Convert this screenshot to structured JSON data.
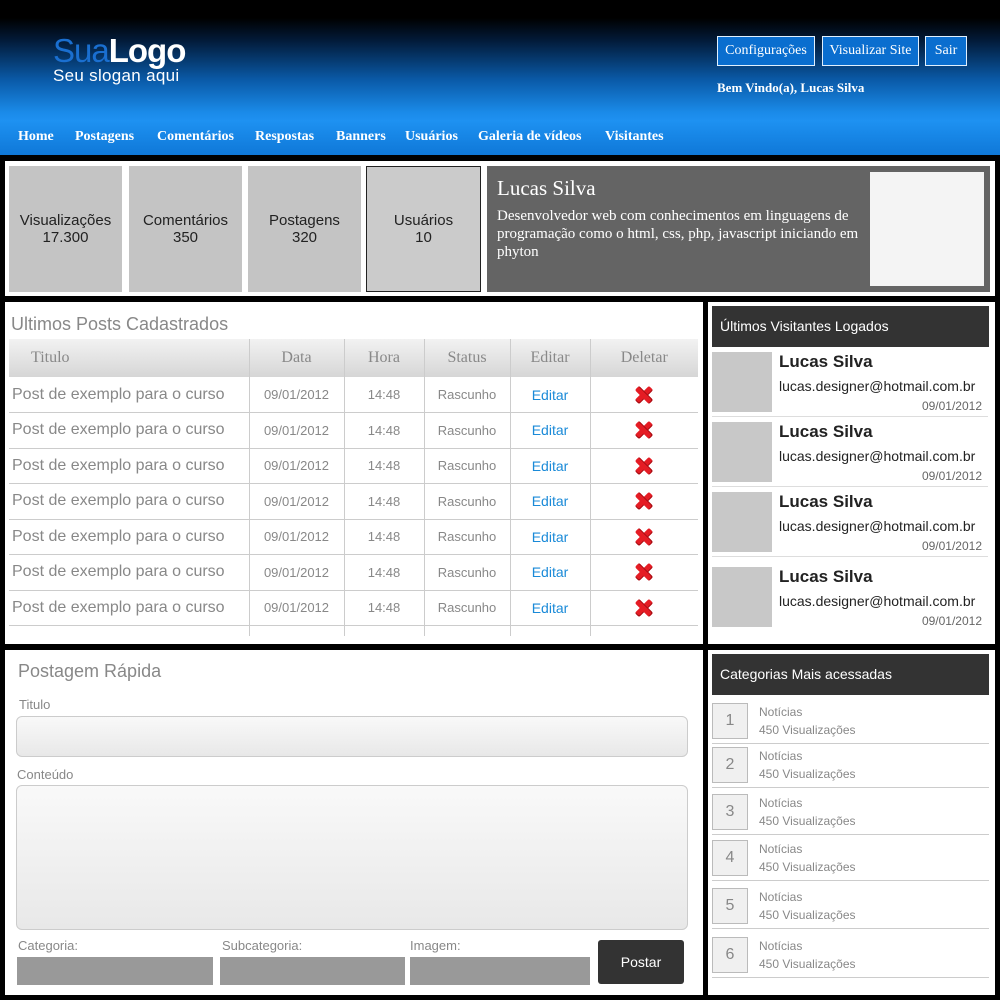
{
  "header": {
    "logo_sua": "Sua",
    "logo_main": "Logo",
    "slogan": "Seu slogan aqui",
    "buttons": [
      "Configurações",
      "Visualizar Site",
      "Sair"
    ],
    "welcome": "Bem Vindo(a), Lucas Silva"
  },
  "nav": [
    "Home",
    "Postagens",
    "Comentários",
    "Respostas",
    "Banners",
    "Usuários",
    "Galeria de vídeos",
    "Visitantes"
  ],
  "stats": [
    {
      "label": "Visualizações",
      "value": "17.300"
    },
    {
      "label": "Comentários",
      "value": "350"
    },
    {
      "label": "Postagens",
      "value": "320"
    },
    {
      "label": "Usuários",
      "value": "10"
    }
  ],
  "profile": {
    "name": "Lucas Silva",
    "description": "Desenvolvedor web com conhecimentos em linguagens de programação como o html, css, php, javascript iniciando em phyton"
  },
  "posts": {
    "title": "Ultimos Posts Cadastrados",
    "columns": [
      "Titulo",
      "Data",
      "Hora",
      "Status",
      "Editar",
      "Deletar"
    ],
    "rows": [
      {
        "title": "Post de exemplo para o curso",
        "date": "09/01/2012",
        "time": "14:48",
        "status": "Rascunho",
        "edit": "Editar"
      },
      {
        "title": "Post de exemplo para o curso",
        "date": "09/01/2012",
        "time": "14:48",
        "status": "Rascunho",
        "edit": "Editar"
      },
      {
        "title": "Post de exemplo para o curso",
        "date": "09/01/2012",
        "time": "14:48",
        "status": "Rascunho",
        "edit": "Editar"
      },
      {
        "title": "Post de exemplo para o curso",
        "date": "09/01/2012",
        "time": "14:48",
        "status": "Rascunho",
        "edit": "Editar"
      },
      {
        "title": "Post de exemplo para o curso",
        "date": "09/01/2012",
        "time": "14:48",
        "status": "Rascunho",
        "edit": "Editar"
      },
      {
        "title": "Post de exemplo para o curso",
        "date": "09/01/2012",
        "time": "14:48",
        "status": "Rascunho",
        "edit": "Editar"
      },
      {
        "title": "Post de exemplo para o curso",
        "date": "09/01/2012",
        "time": "14:48",
        "status": "Rascunho",
        "edit": "Editar"
      }
    ]
  },
  "visitors": {
    "title": "Últimos Visitantes Logados",
    "items": [
      {
        "name": "Lucas Silva",
        "email": "lucas.designer@hotmail.com.br",
        "date": "09/01/2012"
      },
      {
        "name": "Lucas Silva",
        "email": "lucas.designer@hotmail.com.br",
        "date": "09/01/2012"
      },
      {
        "name": "Lucas Silva",
        "email": "lucas.designer@hotmail.com.br",
        "date": "09/01/2012"
      },
      {
        "name": "Lucas Silva",
        "email": "lucas.designer@hotmail.com.br",
        "date": "09/01/2012"
      }
    ]
  },
  "quick_post": {
    "title": "Postagem Rápida",
    "title_label": "Titulo",
    "content_label": "Conteúdo",
    "category_label": "Categoria:",
    "subcategory_label": "Subcategoria:",
    "image_label": "Imagem:",
    "submit": "Postar"
  },
  "categories": {
    "title": "Categorias Mais acessadas",
    "items": [
      {
        "rank": "1",
        "name": "Notícias",
        "views": "450 Visualizações"
      },
      {
        "rank": "2",
        "name": "Notícias",
        "views": "450 Visualizações"
      },
      {
        "rank": "3",
        "name": "Notícias",
        "views": "450 Visualizações"
      },
      {
        "rank": "4",
        "name": "Notícias",
        "views": "450 Visualizações"
      },
      {
        "rank": "5",
        "name": "Notícias",
        "views": "450 Visualizações"
      },
      {
        "rank": "6",
        "name": "Notícias",
        "views": "450 Visualizações"
      }
    ]
  },
  "colors": {
    "accent": "#1e90f0",
    "dark_panel": "#333333",
    "delete": "#e51c24",
    "link": "#1a8ad8"
  }
}
